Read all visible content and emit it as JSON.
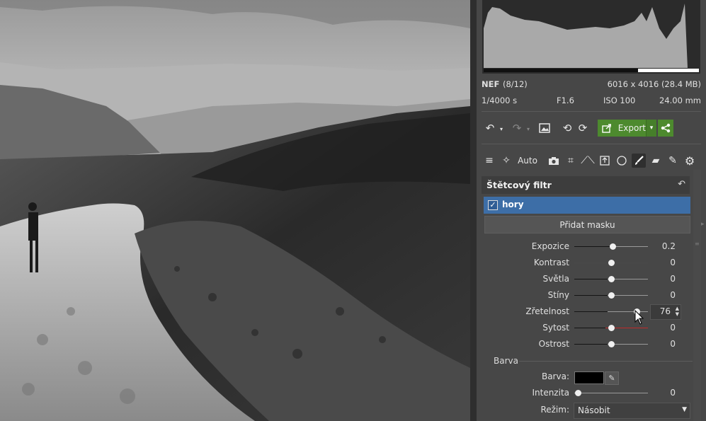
{
  "photo": {
    "description_icon": "landscape-photo"
  },
  "file": {
    "format": "NEF",
    "index": "(8/12)",
    "dims": "6016 x 4016 (28.4 MB)"
  },
  "exif": {
    "shutter": "1/4000 s",
    "aperture": "F1.6",
    "iso": "ISO 100",
    "focal": "24.00 mm"
  },
  "toolbar": {
    "export_label": "Export"
  },
  "tools": {
    "auto_label": "Auto"
  },
  "filter": {
    "title": "Štětcový filtr",
    "mask_name": "hory",
    "mask_checked": "✓",
    "add_mask_label": "Přidat masku"
  },
  "sliders": [
    {
      "label": "Expozice",
      "value": "0.2",
      "pos": 0.52
    },
    {
      "label": "Kontrast",
      "value": "0",
      "pos": 0.5
    },
    {
      "label": "Světla",
      "value": "0",
      "pos": 0.5
    },
    {
      "label": "Stíny",
      "value": "0",
      "pos": 0.5
    },
    {
      "label": "Zřetelnost",
      "value": "76",
      "pos": 0.85
    },
    {
      "label": "Sytost",
      "value": "0",
      "pos": 0.5
    },
    {
      "label": "Ostrost",
      "value": "0",
      "pos": 0.5
    }
  ],
  "color_group": {
    "title": "Barva",
    "color_label": "Barva:",
    "intensity_label": "Intenzita",
    "intensity_value": "0",
    "intensity_pos": 0.05,
    "mode_label": "Režim:",
    "mode_value": "Násobit"
  },
  "colors": {
    "accent_green": "#4d8a2e",
    "selection_blue": "#3d6ea7",
    "panel": "#474747"
  }
}
